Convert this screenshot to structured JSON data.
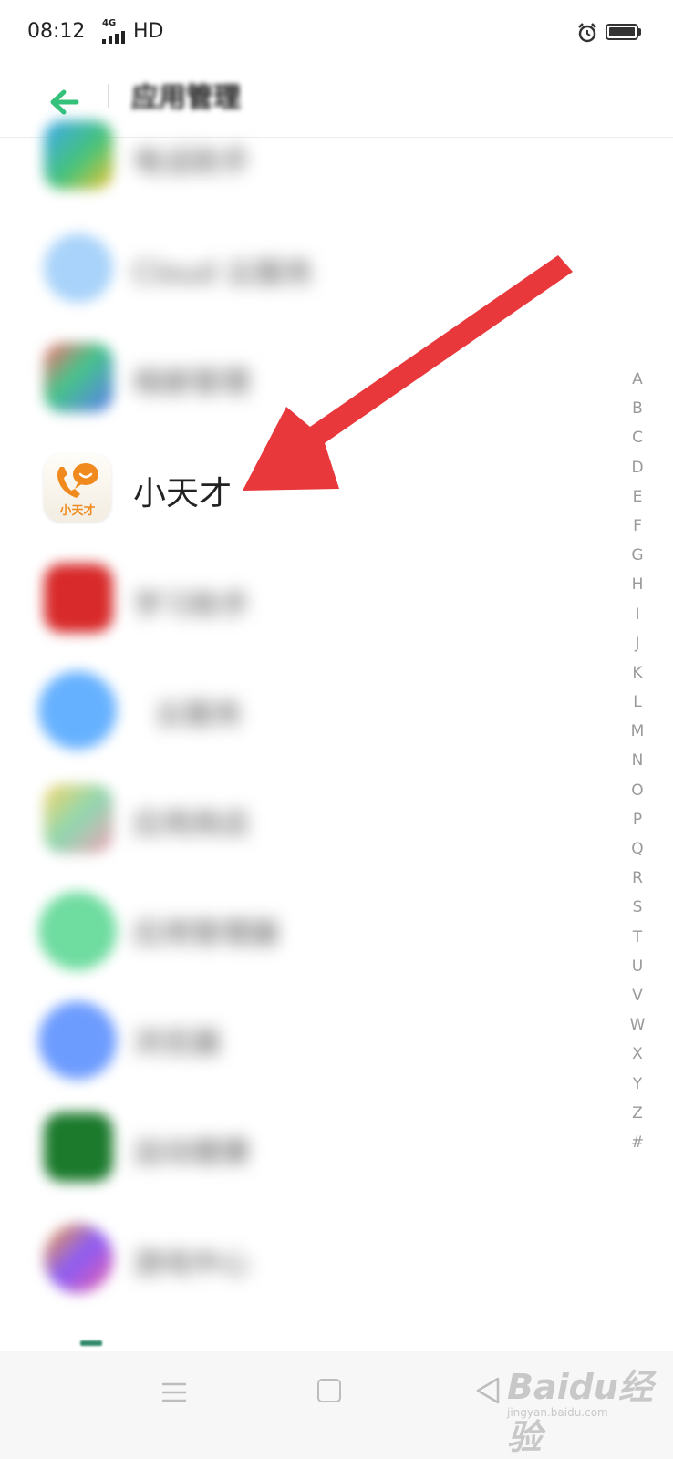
{
  "status_bar": {
    "time": "08:12",
    "network_small": "4G",
    "hd": "HD",
    "icons": [
      "signal-icon",
      "alarm-icon",
      "battery-icon"
    ]
  },
  "header": {
    "title": "应用管理",
    "back_icon": "back-arrow-icon",
    "accent_color": "#34c27a"
  },
  "apps": [
    {
      "label": "电话助手"
    },
    {
      "label": "Cloud 云服务"
    },
    {
      "label": "相册管理"
    },
    {
      "label": "小天才"
    },
    {
      "label": "学习助手"
    },
    {
      "label": "云服务"
    },
    {
      "label": "应用商店"
    },
    {
      "label": "应用管理器"
    },
    {
      "label": "浏览器"
    },
    {
      "label": "运动健康"
    },
    {
      "label": "游戏中心"
    }
  ],
  "alphabet": [
    "A",
    "B",
    "C",
    "D",
    "E",
    "F",
    "G",
    "H",
    "I",
    "J",
    "K",
    "L",
    "M",
    "N",
    "O",
    "P",
    "Q",
    "R",
    "S",
    "T",
    "U",
    "V",
    "W",
    "X",
    "Y",
    "Z",
    "#"
  ],
  "annotation": {
    "arrow_color": "#e8383b"
  },
  "nav_bar": {
    "icons": [
      "menu-icon",
      "home-icon",
      "back-triangle-icon"
    ]
  },
  "watermark": {
    "text": "Baidu经验",
    "sub": "jingyan.baidu.com"
  }
}
